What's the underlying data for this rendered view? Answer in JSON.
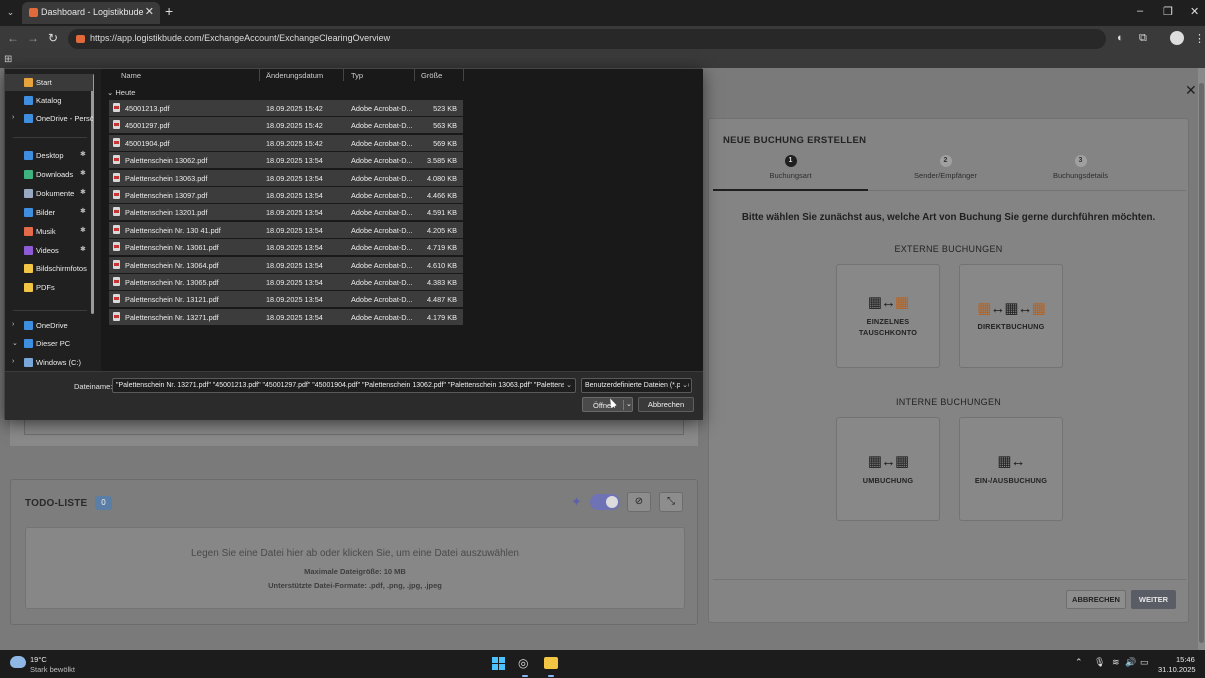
{
  "browser": {
    "tab_title": "Dashboard - Logistikbude",
    "url": "https://app.logistikbude.com/ExchangeAccount/ExchangeClearingOverview",
    "tab_close": "✕",
    "new_tab": "+",
    "win_min": "–",
    "win_max": "❐",
    "win_close": "✕"
  },
  "dialog": {
    "nav_items": [
      {
        "label": "Start",
        "icon": "home-icon",
        "color": "#e8a33d",
        "selected": true,
        "chev": "",
        "pin": ""
      },
      {
        "label": "Katalog",
        "icon": "gallery-icon",
        "color": "#3f8fe0",
        "selected": false,
        "chev": "",
        "pin": ""
      },
      {
        "label": "OneDrive - Persönlich",
        "icon": "cloud-icon",
        "color": "#3f8fe0",
        "selected": false,
        "chev": "›",
        "pin": ""
      },
      {
        "label": "Desktop",
        "icon": "desktop-icon",
        "color": "#3f8fe0",
        "selected": false,
        "chev": "",
        "pin": "✱"
      },
      {
        "label": "Downloads",
        "icon": "download-icon",
        "color": "#3fb37f",
        "selected": false,
        "chev": "",
        "pin": "✱"
      },
      {
        "label": "Dokumente",
        "icon": "document-icon",
        "color": "#9aa9c2",
        "selected": false,
        "chev": "",
        "pin": "✱"
      },
      {
        "label": "Bilder",
        "icon": "pictures-icon",
        "color": "#3f8fe0",
        "selected": false,
        "chev": "",
        "pin": "✱"
      },
      {
        "label": "Musik",
        "icon": "music-icon",
        "color": "#e36b4a",
        "selected": false,
        "chev": "",
        "pin": "✱"
      },
      {
        "label": "Videos",
        "icon": "video-icon",
        "color": "#8f5bd6",
        "selected": false,
        "chev": "",
        "pin": "✱"
      },
      {
        "label": "Bildschirmfotos",
        "icon": "folder-icon",
        "color": "#f2c544",
        "selected": false,
        "chev": "",
        "pin": ""
      },
      {
        "label": "PDFs",
        "icon": "folder-icon",
        "color": "#f2c544",
        "selected": false,
        "chev": "",
        "pin": ""
      },
      {
        "label": "OneDrive",
        "icon": "cloud-icon",
        "color": "#3f8fe0",
        "selected": false,
        "chev": "›",
        "pin": ""
      },
      {
        "label": "Dieser PC",
        "icon": "pc-icon",
        "color": "#3f8fe0",
        "selected": false,
        "chev": "⌄",
        "pin": ""
      },
      {
        "label": "Windows (C:)",
        "icon": "drive-icon",
        "color": "#7aa7d9",
        "selected": false,
        "chev": "›",
        "pin": ""
      }
    ],
    "columns": {
      "name": "Name",
      "date": "Änderungsdatum",
      "type": "Typ",
      "size": "Größe"
    },
    "group": "Heute",
    "group_chev": "⌄",
    "files": [
      {
        "name": "45001213.pdf",
        "date": "18.09.2025 15:42",
        "type": "Adobe Acrobat-D...",
        "size": "523 KB"
      },
      {
        "name": "45001297.pdf",
        "date": "18.09.2025 15:42",
        "type": "Adobe Acrobat-D...",
        "size": "563 KB"
      },
      {
        "name": "45001904.pdf",
        "date": "18.09.2025 15:42",
        "type": "Adobe Acrobat-D...",
        "size": "569 KB"
      },
      {
        "name": "Palettenschein 13062.pdf",
        "date": "18.09.2025 13:54",
        "type": "Adobe Acrobat-D...",
        "size": "3.585 KB"
      },
      {
        "name": "Palettenschein 13063.pdf",
        "date": "18.09.2025 13:54",
        "type": "Adobe Acrobat-D...",
        "size": "4.080 KB"
      },
      {
        "name": "Palettenschein 13097.pdf",
        "date": "18.09.2025 13:54",
        "type": "Adobe Acrobat-D...",
        "size": "4.466 KB"
      },
      {
        "name": "Palettenschein 13201.pdf",
        "date": "18.09.2025 13:54",
        "type": "Adobe Acrobat-D...",
        "size": "4.591 KB"
      },
      {
        "name": "Palettenschein Nr. 130 41.pdf",
        "date": "18.09.2025 13:54",
        "type": "Adobe Acrobat-D...",
        "size": "4.205 KB"
      },
      {
        "name": "Palettenschein Nr. 13061.pdf",
        "date": "18.09.2025 13:54",
        "type": "Adobe Acrobat-D...",
        "size": "4.719 KB"
      },
      {
        "name": "Palettenschein Nr. 13064.pdf",
        "date": "18.09.2025 13:54",
        "type": "Adobe Acrobat-D...",
        "size": "4.610 KB"
      },
      {
        "name": "Palettenschein Nr. 13065.pdf",
        "date": "18.09.2025 13:54",
        "type": "Adobe Acrobat-D...",
        "size": "4.383 KB"
      },
      {
        "name": "Palettenschein Nr. 13121.pdf",
        "date": "18.09.2025 13:54",
        "type": "Adobe Acrobat-D...",
        "size": "4.487 KB"
      },
      {
        "name": "Palettenschein Nr. 13271.pdf",
        "date": "18.09.2025 13:54",
        "type": "Adobe Acrobat-D...",
        "size": "4.179 KB"
      }
    ],
    "filename_label": "Dateiname:",
    "filename_value": "\"Palettenschein Nr. 13271.pdf\" \"45001213.pdf\" \"45001297.pdf\" \"45001904.pdf\" \"Palettenschein 13062.pdf\" \"Palettenschein 13063.pdf\" \"Palettensc",
    "filetype_value": "Benutzerdefinierte Dateien (*.pdf)",
    "open_label": "Öffnen",
    "cancel_label": "Abbrechen",
    "dropdown_glyph": "⌄"
  },
  "todo": {
    "title": "TODO-LISTE",
    "count": "0",
    "sparkle": "✦",
    "filter_icon": "⊘",
    "collapse_icon": "⤡",
    "dropzone_text": "Legen Sie eine Datei hier ab oder klicken Sie, um eine Datei auszuwählen",
    "max_size": "Maximale Dateigröße: 10 MB",
    "formats": "Unterstützte Datei-Formate: .pdf, .png, .jpg, .jpeg"
  },
  "booking": {
    "close": "✕",
    "title": "NEUE BUCHUNG ERSTELLEN",
    "steps": [
      {
        "num": "1",
        "label": "Buchungsart"
      },
      {
        "num": "2",
        "label": "Sender/Empfänger"
      },
      {
        "num": "3",
        "label": "Buchungsdetails"
      }
    ],
    "question": "Bitte wählen Sie zunächst aus, welche Art von Buchung Sie gerne durchführen möchten.",
    "external_label": "EXTERNE BUCHUNGEN",
    "internal_label": "INTERNE BUCHUNGEN",
    "tiles": {
      "single_account_line1": "EINZELNES",
      "single_account_line2": "TAUSCHKONTO",
      "direct": "DIREKTBUCHUNG",
      "transfer": "UMBUCHUNG",
      "in_out": "EIN-/AUSBUCHUNG"
    },
    "cancel_label": "ABBRECHEN",
    "next_label": "WEITER",
    "accent_orange": "#b8621e"
  },
  "taskbar": {
    "temperature": "19°C",
    "weather": "Stark bewölkt",
    "time": "15:46",
    "date": "31.10.2025",
    "tray_up": "⌃",
    "tray_mic": "🎙",
    "tray_wifi": "≋",
    "tray_sound": "🔊",
    "tray_battery": "▭"
  }
}
